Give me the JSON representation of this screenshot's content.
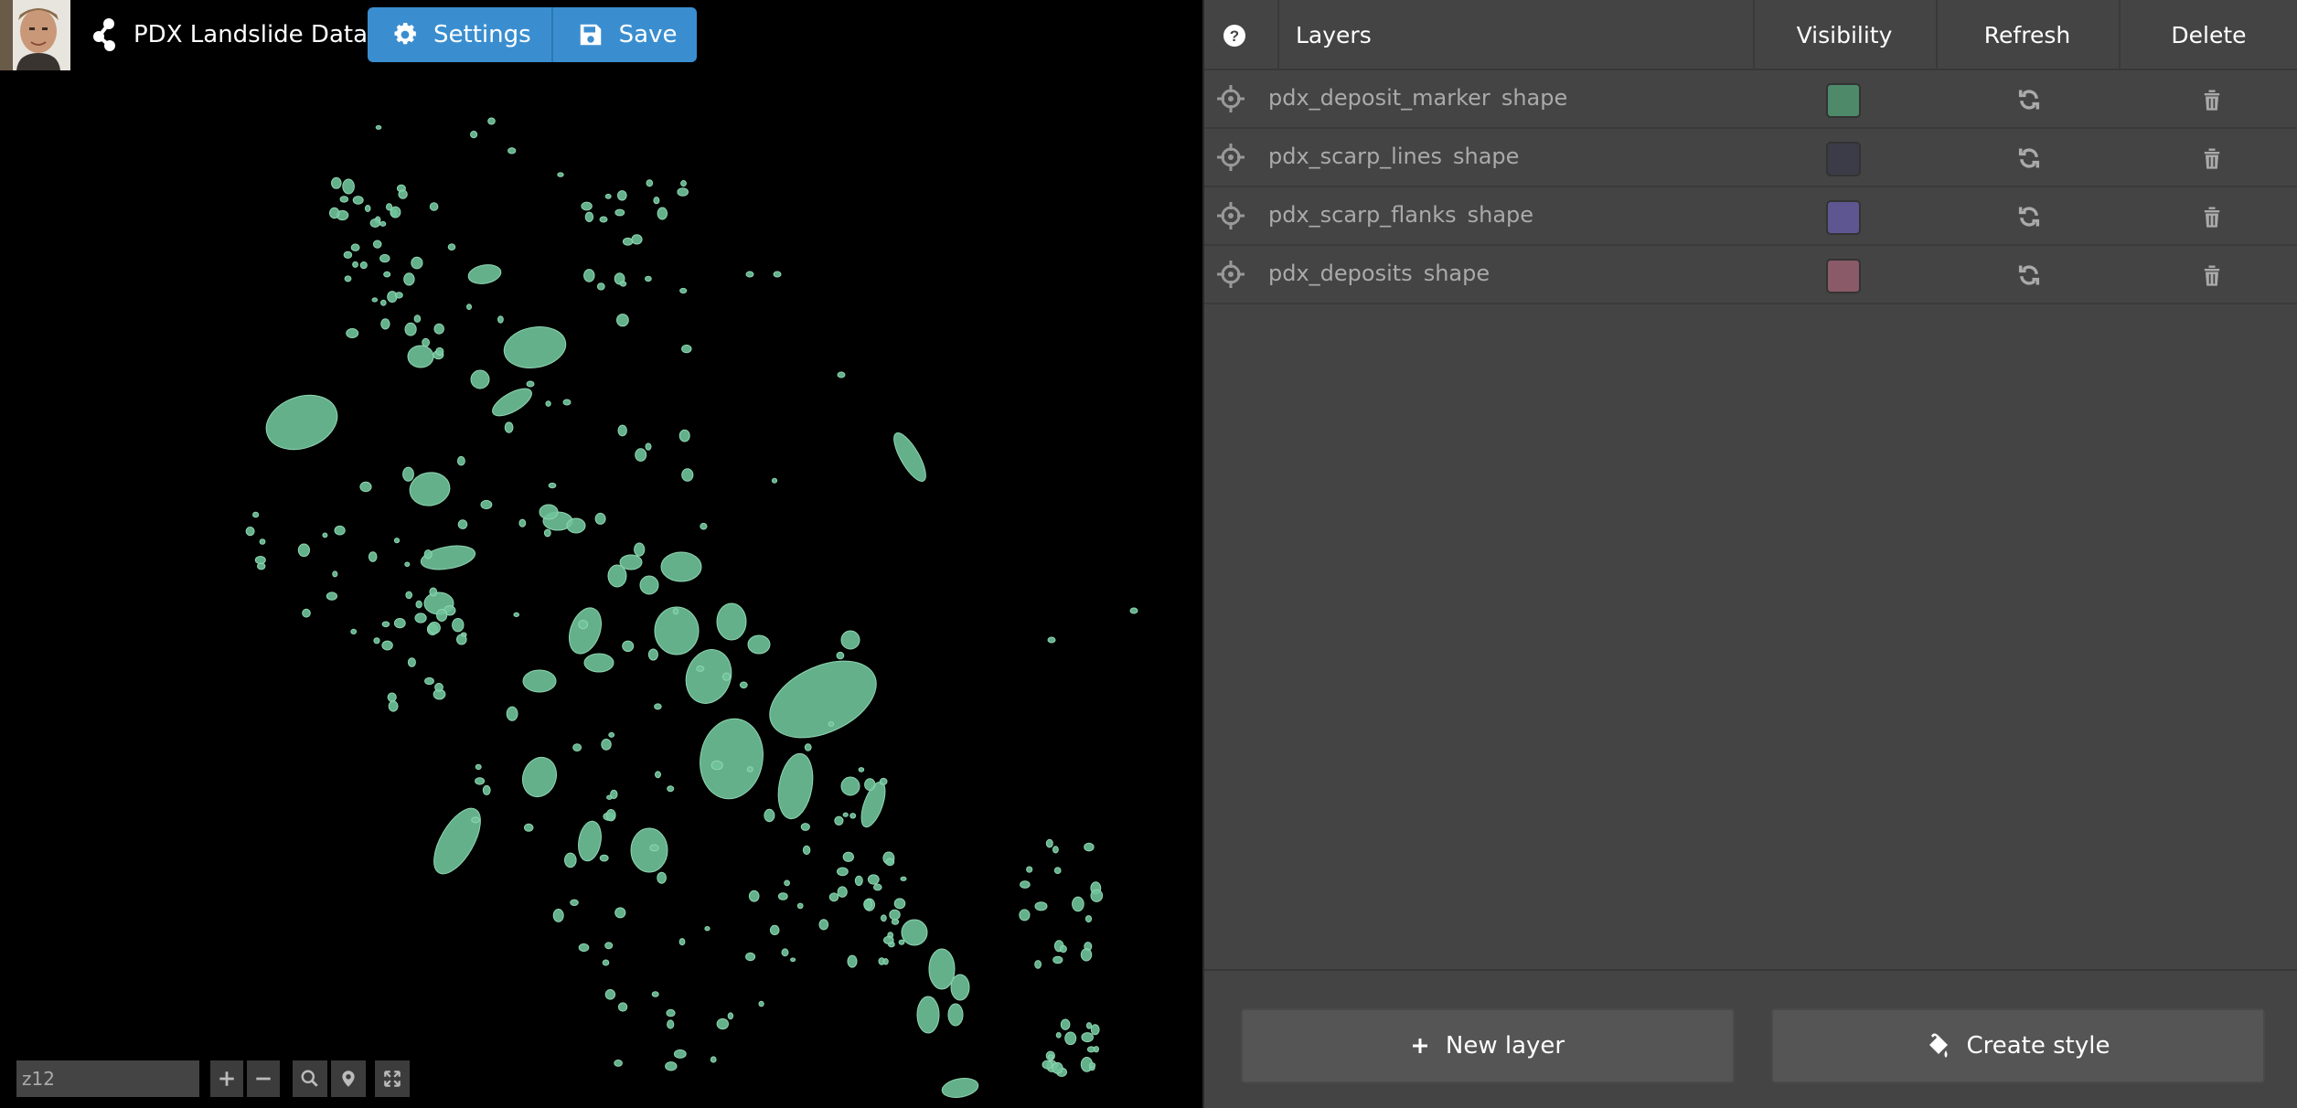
{
  "app": {
    "title": "PDX Landslide Data"
  },
  "toolbar": {
    "settings_label": "Settings",
    "save_label": "Save",
    "accent": "#3a8ed0"
  },
  "map": {
    "zoom_label": "z12",
    "feature_color": "#6fc39a",
    "controls": [
      "zoom-in-icon",
      "zoom-out-icon",
      "search-icon",
      "location-pin-icon",
      "fullscreen-icon"
    ]
  },
  "panel": {
    "headers": {
      "help": "?",
      "layers": "Layers",
      "visibility": "Visibility",
      "refresh": "Refresh",
      "delete": "Delete"
    },
    "layers": [
      {
        "name": "pdx_deposit_marker",
        "type": "shape",
        "color": "#4e8a6a"
      },
      {
        "name": "pdx_scarp_lines",
        "type": "shape",
        "color": "#3c3c48"
      },
      {
        "name": "pdx_scarp_flanks",
        "type": "shape",
        "color": "#5d5690"
      },
      {
        "name": "pdx_deposits",
        "type": "shape",
        "color": "#8a5a68"
      }
    ],
    "new_layer_label": "New layer",
    "create_style_label": "Create style"
  }
}
